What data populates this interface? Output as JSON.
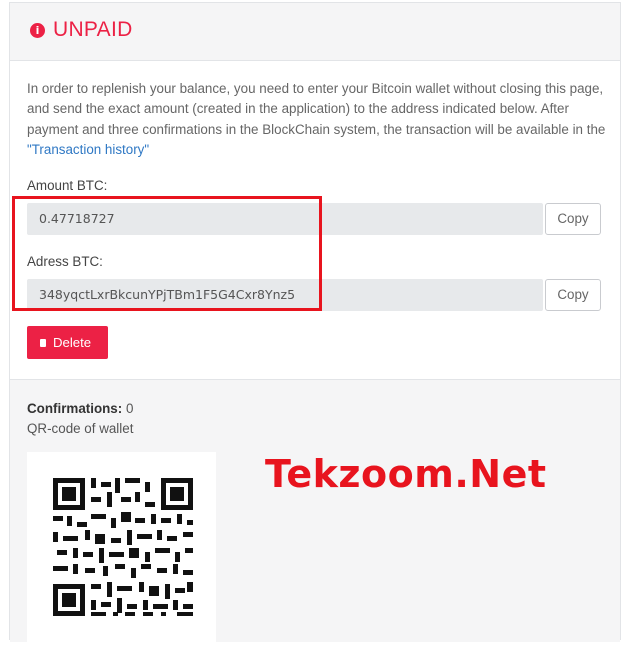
{
  "header": {
    "status": "UNPAID",
    "status_icon": "info-circle-icon",
    "accent_color": "#ec2145"
  },
  "intro": {
    "text": "In order to replenish your balance, you need to enter your Bitcoin wallet without closing this page, and send the exact amount (created in the application) to the address indicated below. After payment and three confirmations in the BlockChain system, the transaction will be available in the ",
    "link_text": "\"Transaction history\""
  },
  "amount": {
    "label": "Amount BTC:",
    "value": "0.47718727",
    "copy_label": "Copy"
  },
  "address": {
    "label": "Adress BTC:",
    "value": "348yqctLxrBkcunYPjTBm1F5G4Cxr8Ynz5",
    "copy_label": "Copy"
  },
  "actions": {
    "delete_label": "Delete",
    "delete_icon": "trash-icon"
  },
  "confirmations": {
    "label": "Confirmations:",
    "count": "0"
  },
  "qr": {
    "label": "QR-code of wallet"
  },
  "watermark": {
    "text": "Tekzoom.Net",
    "color": "#e8141e"
  }
}
